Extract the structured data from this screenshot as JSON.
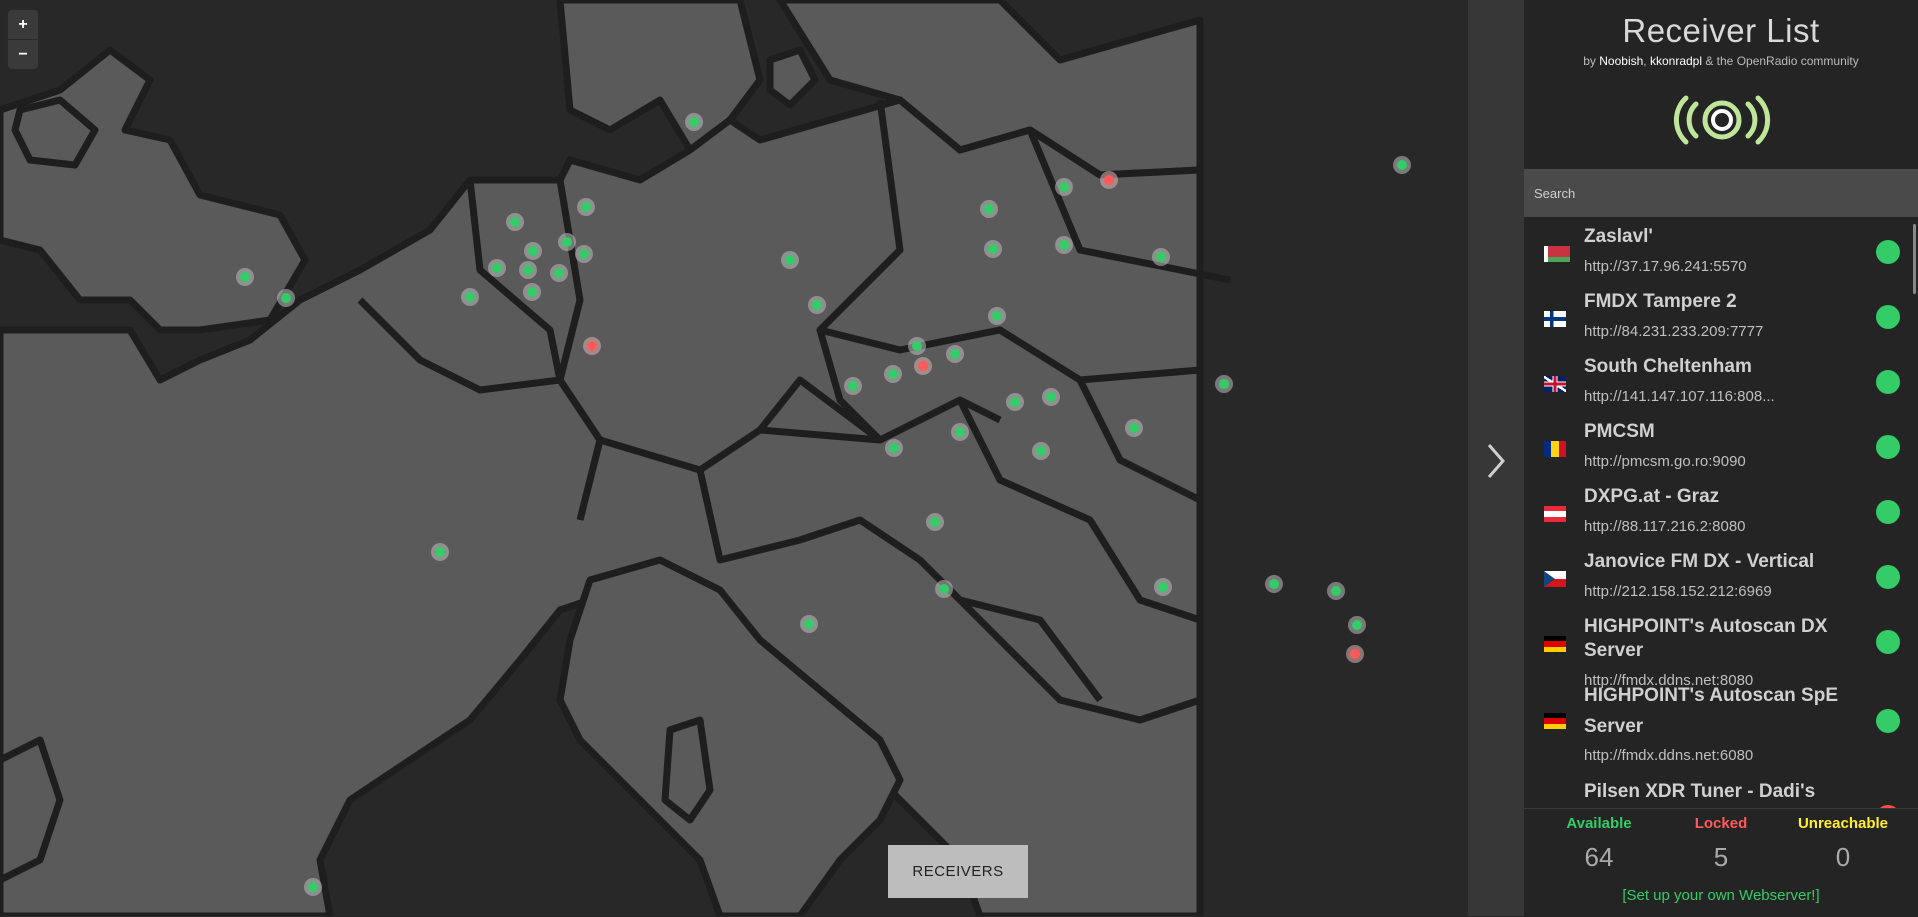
{
  "map": {
    "zoom_in": "+",
    "zoom_out": "−",
    "receivers_button": "RECEIVERS"
  },
  "panel": {
    "title": "Receiver List",
    "subtitle_prefix": "by ",
    "author1": "Noobish",
    "sep": ", ",
    "author2": "kkonradpl",
    "subtitle_suffix": " & the OpenRadio community",
    "search_placeholder": "Search"
  },
  "receivers": [
    {
      "name": "Zaslavl'",
      "url": "http://37.17.96.241:5570",
      "status": "available",
      "flag": "belarus"
    },
    {
      "name": "FMDX Tampere 2",
      "url": "http://84.231.233.209:7777",
      "status": "available",
      "flag": "finland"
    },
    {
      "name": "South Cheltenham",
      "url": "http://141.147.107.116:808...",
      "status": "available",
      "flag": "uk"
    },
    {
      "name": "PMCSM",
      "url": "http://pmcsm.go.ro:9090",
      "status": "available",
      "flag": "romania"
    },
    {
      "name": "DXPG.at - Graz",
      "url": "http://88.117.216.2:8080",
      "status": "available",
      "flag": "austria"
    },
    {
      "name": "Janovice FM DX - Vertical",
      "url": "http://212.158.152.212:6969",
      "status": "available",
      "flag": "czechia"
    },
    {
      "name": "HIGHPOINT's Autoscan DX Server",
      "url": "http://fmdx.ddns.net:8080",
      "status": "available",
      "flag": "germany"
    },
    {
      "name": "HIGHPOINT's Autoscan SpE Server",
      "url": "http://fmdx.ddns.net:6080",
      "status": "available",
      "flag": "germany"
    },
    {
      "name": "Pilsen XDR Tuner - Dadi's server",
      "url": "",
      "status": "locked",
      "flag": "czechia"
    }
  ],
  "stats": {
    "available_label": "Available",
    "available_count": "64",
    "locked_label": "Locked",
    "locked_count": "5",
    "unreachable_label": "Unreachable",
    "unreachable_count": "0",
    "setup_link": "[Set up your own Webserver!]"
  },
  "colors": {
    "available": "#33cc66",
    "locked": "#ff5a5a",
    "unreachable": "#ffee33",
    "land": "#5a5a5a",
    "water": "#282828",
    "border": "#1e1e1e"
  },
  "map_marker_statuses": [
    "available",
    "available",
    "available",
    "available",
    "available",
    "available",
    "available",
    "available",
    "available",
    "available",
    "available",
    "available",
    "available",
    "available",
    "available",
    "available",
    "locked",
    "available",
    "available",
    "available",
    "available",
    "available",
    "available",
    "available",
    "locked",
    "available",
    "available",
    "locked",
    "available",
    "available",
    "available",
    "available",
    "available",
    "available",
    "available",
    "available",
    "available",
    "available",
    "available",
    "available",
    "locked",
    "available",
    "available",
    "available"
  ]
}
